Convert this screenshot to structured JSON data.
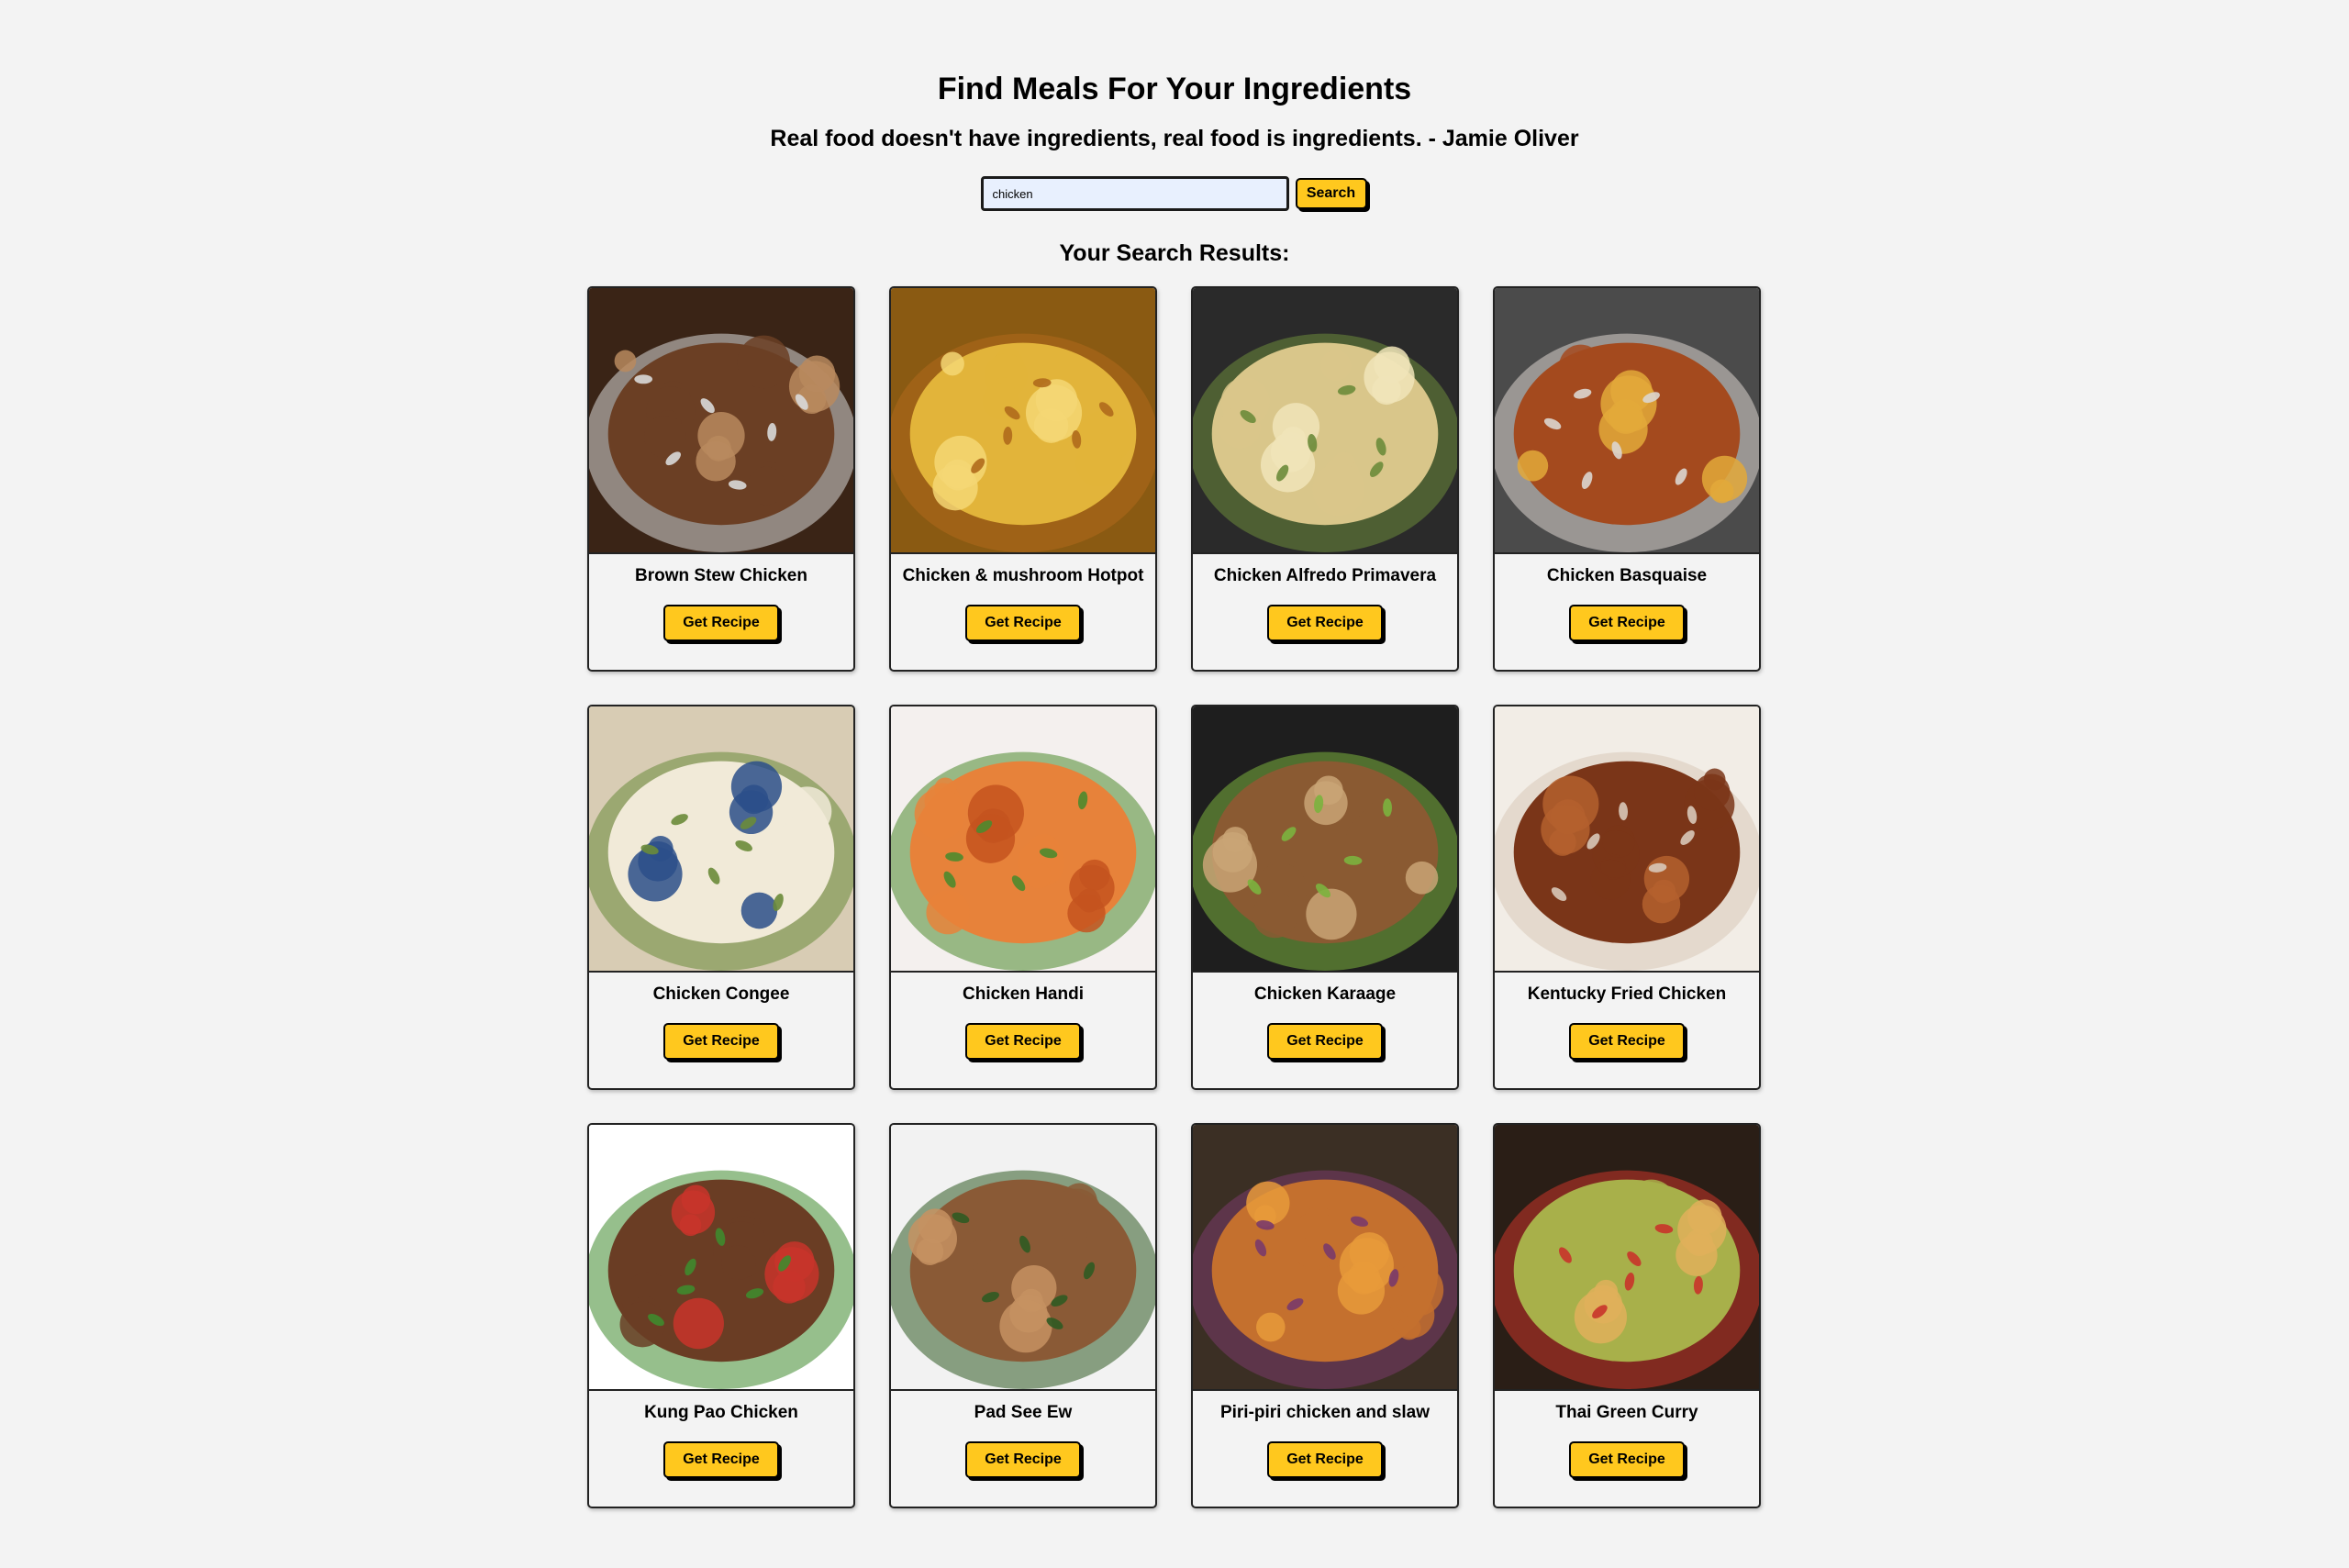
{
  "header": {
    "title": "Find Meals For Your Ingredients",
    "quote": "Real food doesn't have ingredients, real food is ingredients. - Jamie Oliver"
  },
  "search": {
    "value": "chicken",
    "button_label": "Search"
  },
  "results": {
    "heading": "Your Search Results:",
    "button_label": "Get Recipe",
    "meals": [
      {
        "name": "Brown Stew Chicken",
        "image": "bowl of dark braised brown stew chicken",
        "palette": [
          "#3a2416",
          "#6b3f24",
          "#b98a5e",
          "#d9d9d9"
        ]
      },
      {
        "name": "Chicken & mushroom Hotpot",
        "image": "golden sliced potato topped hotpot",
        "palette": [
          "#8a5a12",
          "#e2b43a",
          "#f4d774",
          "#b06a1c"
        ]
      },
      {
        "name": "Chicken Alfredo Primavera",
        "image": "skillet of creamy pasta with chicken and vegetables",
        "palette": [
          "#2a2a2a",
          "#d9c68a",
          "#f0e4b8",
          "#6b8b3a"
        ]
      },
      {
        "name": "Chicken Basquaise",
        "image": "chicken and peppers in a cast iron pan",
        "palette": [
          "#4b4b4b",
          "#a44a1e",
          "#e3a93a",
          "#dcd6cf"
        ]
      },
      {
        "name": "Chicken Congee",
        "image": "rice porridge in a blue patterned bowl",
        "palette": [
          "#d8ccb4",
          "#f1ead8",
          "#2c4f8a",
          "#6a8b3a"
        ]
      },
      {
        "name": "Chicken Handi",
        "image": "orange chicken curry on a white plate",
        "palette": [
          "#f4f0ee",
          "#e7823a",
          "#c4541e",
          "#4c8a2e"
        ]
      },
      {
        "name": "Chicken Karaage",
        "image": "fried chicken with sauce on lettuce",
        "palette": [
          "#1e1e1e",
          "#8a5a32",
          "#c9a476",
          "#7bb33e"
        ]
      },
      {
        "name": "Kentucky Fried Chicken",
        "image": "crispy fried chicken pieces",
        "palette": [
          "#f2ede6",
          "#7a3518",
          "#b4602e",
          "#d8c8b8"
        ]
      },
      {
        "name": "Kung Pao Chicken",
        "image": "stir fried chicken with peppers and peanuts",
        "palette": [
          "#ffffff",
          "#6a3d24",
          "#c8342a",
          "#3f8a2e"
        ]
      },
      {
        "name": "Pad See Ew",
        "image": "wide rice noodles lifted with chopsticks",
        "palette": [
          "#f2f2f2",
          "#8a5a36",
          "#c69262",
          "#2f5a22"
        ]
      },
      {
        "name": "Piri-piri chicken and slaw",
        "image": "grilled piri-piri chicken with slaw and wedges",
        "palette": [
          "#3b2f24",
          "#c4702e",
          "#e79a3a",
          "#7a3a6a"
        ]
      },
      {
        "name": "Thai Green Curry",
        "image": "green curry bowl with flatbread",
        "palette": [
          "#2a1e16",
          "#a8b04a",
          "#e0b05a",
          "#c8342a"
        ]
      }
    ]
  }
}
